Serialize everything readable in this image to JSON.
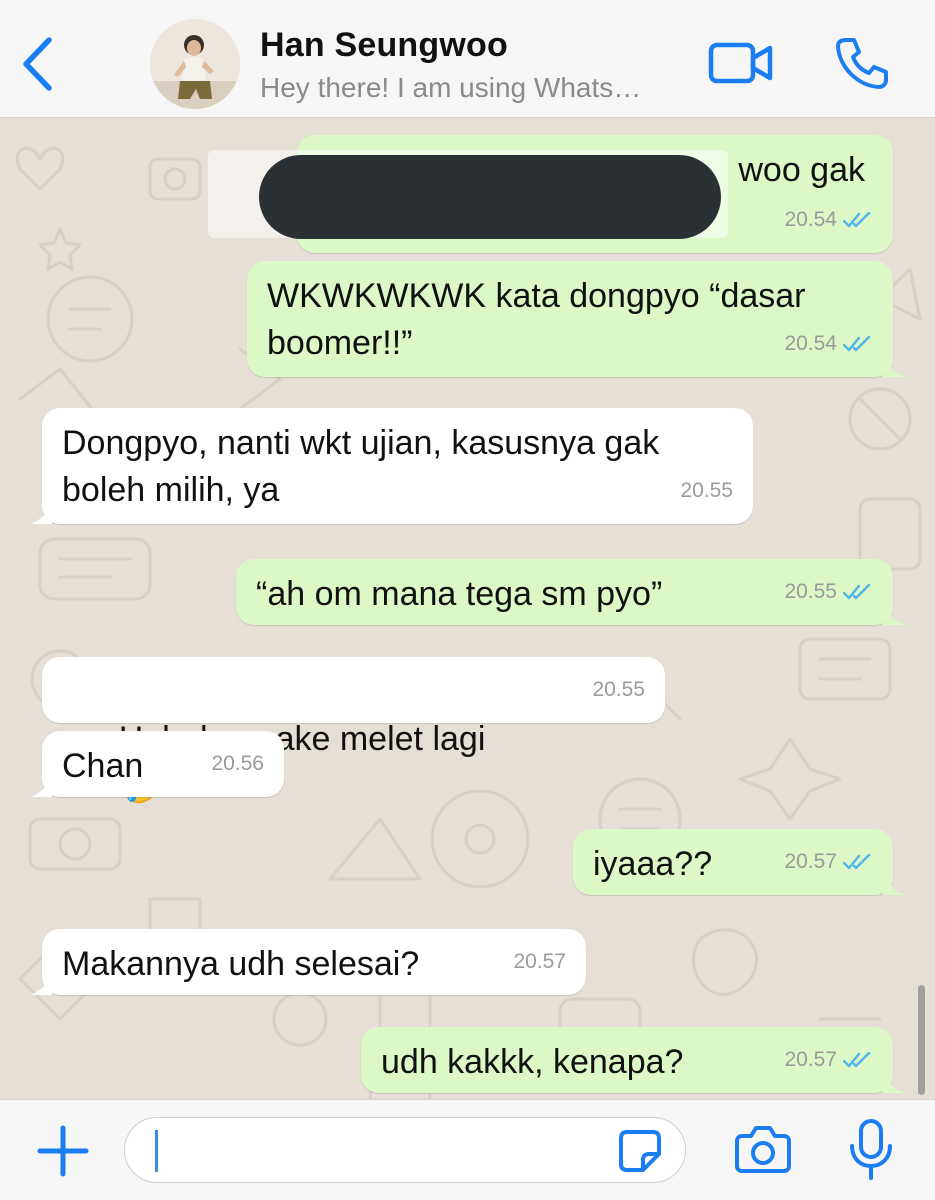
{
  "colors": {
    "accent": "#1a7ef2",
    "outgoing_bubble": "#dcf8c6",
    "incoming_bubble": "#ffffff",
    "read_ticks": "#4fb6ec",
    "chat_background": "#e6dfd6"
  },
  "header": {
    "back_icon": "chevron-left-icon",
    "contact_name": "Han Seungwoo",
    "status": "Hey there! I am using Whats…",
    "video_icon": "video-camera-icon",
    "call_icon": "phone-icon"
  },
  "messages": [
    {
      "direction": "out",
      "text": "woo gak",
      "time": "20.54",
      "status": "read",
      "partially_redacted": true
    },
    {
      "direction": "out",
      "text": "WKWKWKWK kata dongpyo “dasar\nboomer!!”",
      "time": "20.54",
      "status": "read"
    },
    {
      "direction": "in",
      "text": "Dongpyo, nanti wkt ujian, kasusnya gak\nboleh milih, ya",
      "time": "20.55"
    },
    {
      "direction": "out",
      "text": "“ah om mana tega sm pyo”",
      "time": "20.55",
      "status": "read"
    },
    {
      "direction": "in",
      "text": "Hahaha, pake melet lagi",
      "emoji": "🤣",
      "time": "20.55"
    },
    {
      "direction": "in",
      "text": "Chan",
      "time": "20.56"
    },
    {
      "direction": "out",
      "text": "iyaaa??",
      "time": "20.57",
      "status": "read"
    },
    {
      "direction": "in",
      "text": "Makannya udh selesai?",
      "time": "20.57"
    },
    {
      "direction": "out",
      "text": "udh kakkk, kenapa?",
      "time": "20.57",
      "status": "read"
    }
  ],
  "input_bar": {
    "attach_icon": "plus-icon",
    "text_value": "",
    "sticker_icon": "sticker-icon",
    "camera_icon": "camera-icon",
    "mic_icon": "microphone-icon"
  }
}
